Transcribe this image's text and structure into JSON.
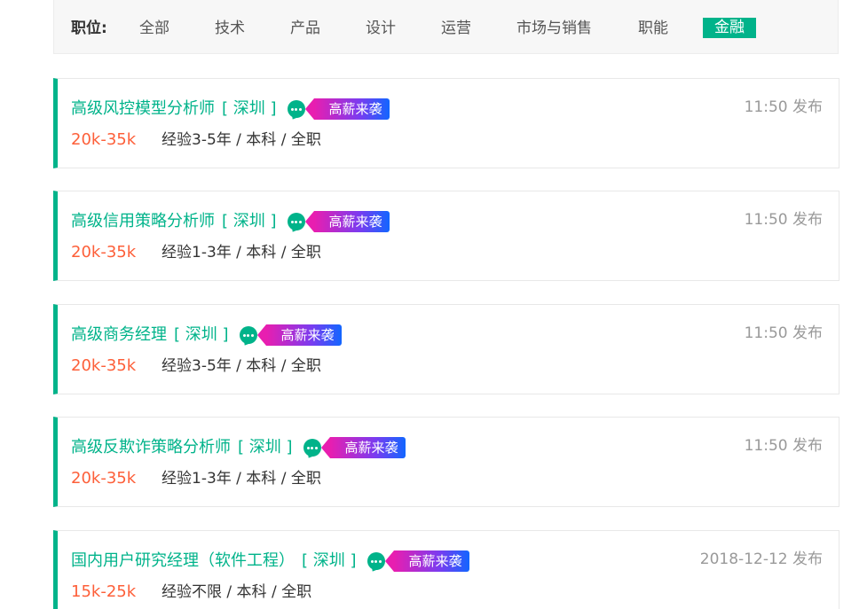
{
  "filter": {
    "label": "职位:",
    "items": [
      "全部",
      "技术",
      "产品",
      "设计",
      "运营",
      "市场与销售",
      "职能",
      "金融"
    ],
    "active": "金融"
  },
  "jobs": [
    {
      "title": "高级风控模型分析师",
      "city": "[ 深圳 ]",
      "tag": "高薪来袭",
      "time": "11:50 发布",
      "salary": "20k-35k",
      "requirements": "经验3-5年 / 本科 / 全职"
    },
    {
      "title": "高级信用策略分析师",
      "city": "[ 深圳 ]",
      "tag": "高薪来袭",
      "time": "11:50 发布",
      "salary": "20k-35k",
      "requirements": "经验1-3年 / 本科 / 全职"
    },
    {
      "title": "高级商务经理",
      "city": "[ 深圳 ]",
      "tag": "高薪来袭",
      "time": "11:50 发布",
      "salary": "20k-35k",
      "requirements": "经验3-5年 / 本科 / 全职"
    },
    {
      "title": "高级反欺诈策略分析师",
      "city": "[ 深圳 ]",
      "tag": "高薪来袭",
      "time": "11:50 发布",
      "salary": "20k-35k",
      "requirements": "经验1-3年 / 本科 / 全职"
    },
    {
      "title": "国内用户研究经理（软件工程）",
      "city": "[ 深圳 ]",
      "tag": "高薪来袭",
      "time": "2018-12-12 发布",
      "salary": "15k-25k",
      "requirements": "经验不限 / 本科 / 全职"
    }
  ],
  "icons": {
    "chat": "chat-bubble-icon"
  },
  "colors": {
    "accent": "#00b38a",
    "salary": "#fd5f39",
    "tag_gradient_start": "#e81eb0",
    "tag_gradient_end": "#1266ff"
  }
}
